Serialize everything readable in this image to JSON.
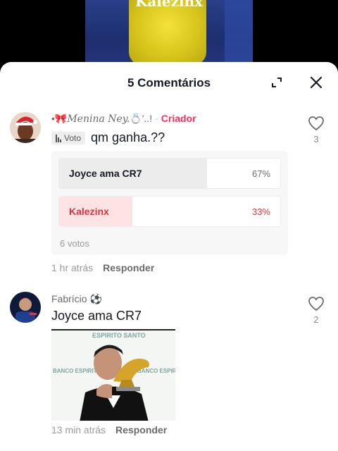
{
  "video": {
    "caption": "Kalezinx"
  },
  "header": {
    "title": "5 Comentários"
  },
  "comments": [
    {
      "username_decor": "•🎀",
      "username": "Menina Ney.",
      "username_tail": "💍'..!",
      "creator_badge": "Criador",
      "vote_tag": "Voto",
      "text": "qm ganha.??",
      "likes": "3",
      "poll": {
        "options": [
          {
            "label": "Joyce ama CR7",
            "percent": "67%",
            "fraction": 0.67
          },
          {
            "label": "Kalezinx",
            "percent": "33%",
            "fraction": 0.33
          }
        ],
        "votes": "6 votos"
      },
      "time": "1 hr atrás",
      "reply": "Responder"
    },
    {
      "username": "Fabrício ⚽",
      "text": "Joyce ama CR7",
      "likes": "2",
      "photo_text": {
        "top": "ESPIRITO SANTO",
        "left": "BANCO ESPIRITO SANTO",
        "right": "BANCO ESPIRITO SANTO"
      },
      "time": "13 min atrás",
      "reply": "Responder"
    }
  ],
  "colors": {
    "accent": "#fe2c55",
    "poll_fill_1": "#ececec",
    "poll_fill_2": "#fde3e3"
  }
}
